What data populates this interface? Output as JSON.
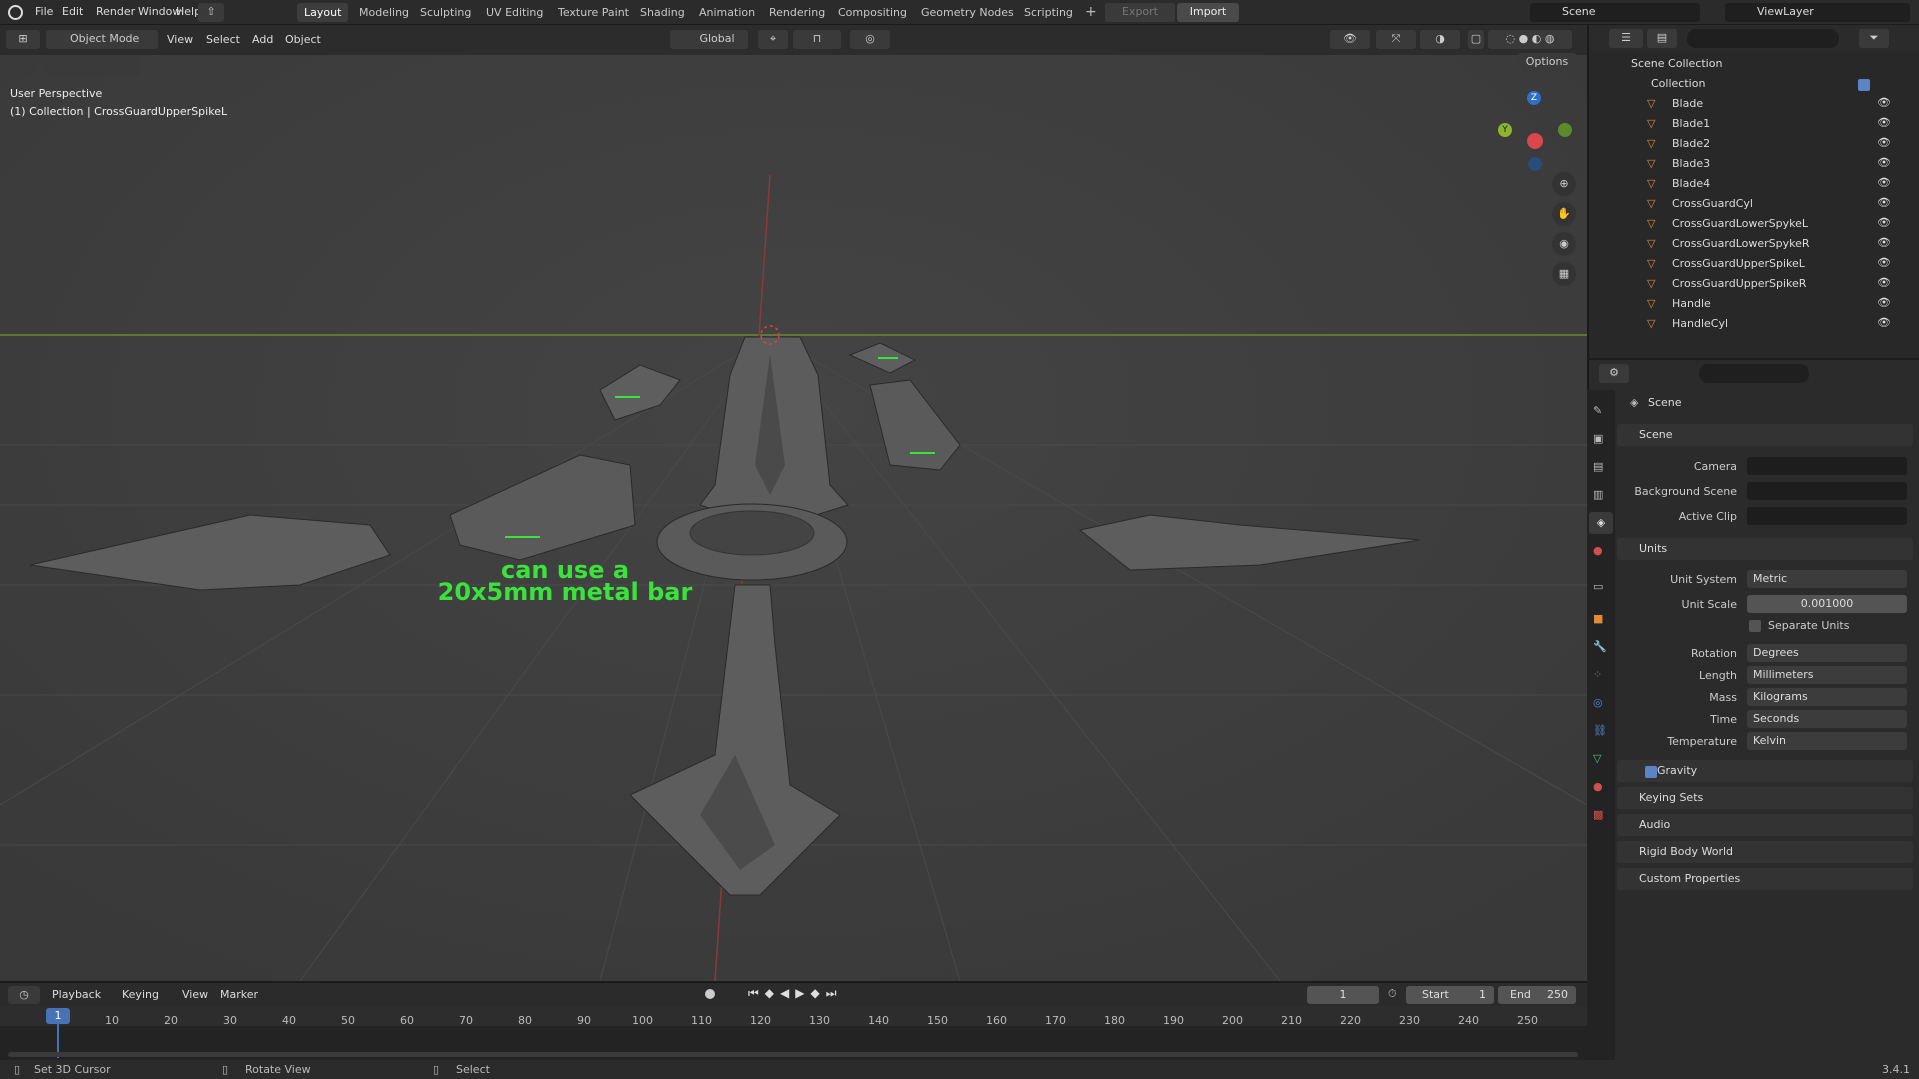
{
  "topbar": {
    "menus": [
      "File",
      "Edit",
      "Render",
      "Window",
      "Help"
    ],
    "workspaces": [
      "Layout",
      "Modeling",
      "Sculpting",
      "UV Editing",
      "Texture Paint",
      "Shading",
      "Animation",
      "Rendering",
      "Compositing",
      "Geometry Nodes",
      "Scripting"
    ],
    "export_label": "Export",
    "import_label": "Import",
    "scene_name": "Scene",
    "viewlayer_name": "ViewLayer"
  },
  "viewport_header": {
    "mode": "Object Mode",
    "menus": [
      "View",
      "Select",
      "Add",
      "Object"
    ],
    "transform_orientation": "Global",
    "options_label": "Options"
  },
  "viewport": {
    "perspective_label": "User Perspective",
    "collection_label": "(1) Collection | CrossGuardUpperSpikeL",
    "annotation_line1": "can use a",
    "annotation_line2": "20x5mm metal bar",
    "annotation_color": "#39e33a",
    "gizmo": {
      "x": "X",
      "y": "Y",
      "z": "Z"
    }
  },
  "outliner": {
    "root": "Scene Collection",
    "collection": "Collection",
    "items": [
      "Blade",
      "Blade1",
      "Blade2",
      "Blade3",
      "Blade4",
      "CrossGuardCyl",
      "CrossGuardLowerSpykeL",
      "CrossGuardLowerSpykeR",
      "CrossGuardUpperSpikeL",
      "CrossGuardUpperSpikeR",
      "Handle",
      "HandleCyl"
    ]
  },
  "properties": {
    "context": "Scene",
    "scene_panel": "Scene",
    "camera_label": "Camera",
    "background_label": "Background Scene",
    "clip_label": "Active Clip",
    "units_panel": "Units",
    "unit_system_label": "Unit System",
    "unit_system": "Metric",
    "unit_scale_label": "Unit Scale",
    "unit_scale": "0.001000",
    "separate_units": "Separate Units",
    "rotation_label": "Rotation",
    "rotation": "Degrees",
    "length_label": "Length",
    "length": "Millimeters",
    "mass_label": "Mass",
    "mass": "Kilograms",
    "time_label": "Time",
    "time": "Seconds",
    "temperature_label": "Temperature",
    "temperature": "Kelvin",
    "panels": [
      "Gravity",
      "Keying Sets",
      "Audio",
      "Rigid Body World",
      "Custom Properties"
    ]
  },
  "timeline": {
    "menus": [
      "Playback",
      "Keying",
      "View",
      "Marker"
    ],
    "current_frame": "1",
    "start_label": "Start",
    "start": "1",
    "end_label": "End",
    "end": "250",
    "ticks": [
      "10",
      "20",
      "30",
      "40",
      "50",
      "60",
      "70",
      "80",
      "90",
      "100",
      "110",
      "120",
      "130",
      "140",
      "150",
      "160",
      "170",
      "180",
      "190",
      "200",
      "210",
      "220",
      "230",
      "240",
      "250"
    ],
    "playhead": "1"
  },
  "statusbar": {
    "left": "Set 3D Cursor",
    "middle": "Rotate View",
    "right": "Select",
    "version": "3.4.1"
  }
}
